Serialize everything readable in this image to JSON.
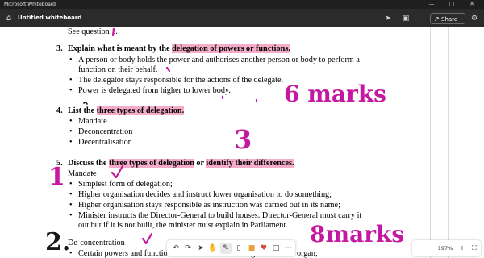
{
  "window": {
    "title": "Microsoft Whiteboard",
    "controls": [
      "minimize-icon",
      "maximize-icon",
      "close-icon"
    ]
  },
  "header": {
    "home_icon": "home-icon",
    "doc_title": "Untitled whiteboard",
    "chevron": "chevron-down-icon",
    "icons": [
      "cursor-icon",
      "gift-icon",
      "settings-icon"
    ],
    "share_label": "Share",
    "share_icon": "share-icon"
  },
  "doc": {
    "line0": "See question 1.",
    "q3_num": "3.",
    "q3_pre": "Explain what is meant by the ",
    "q3_hl": "delegation of powers or functions.",
    "q3_b1a": "A person or body holds the power and authorises another person or body to perform a",
    "q3_b1b": "function on their behalf.",
    "q3_b2": "The delegator stays responsible for the actions of the delegate.",
    "q3_b3": "Power is delegated from higher to lower body.",
    "q4_num": "4.",
    "q4_pre": "List the ",
    "q4_hl": "three types of delegation.",
    "q4_i1": "Mandate",
    "q4_i2": "Deconcentration",
    "q4_i3": "Decentralisation",
    "q5_num": "5.",
    "q5_pre": "Discuss the ",
    "q5_hl1": "three types of delegation",
    "q5_mid": " or ",
    "q5_hl2": "identify their differences.",
    "mandate_head": "Mandate",
    "m_b1": "Simplest form of delegation;",
    "m_b2": "Higher organisation decides and instruct lower organisation to do something;",
    "m_b3": "Higher organisation stays responsible as instruction was carried out in its name;",
    "m_b4a": "Minister instructs the Director-General to build houses.  Director-General must carry it",
    "m_b4b": "out but if it is not built, the minister must explain in Parliament.",
    "deconc_head": "De-concentration",
    "d_b1": "Certain powers and functions are transferred from higher to lower organ;"
  },
  "ink": {
    "marks6": "6 marks",
    "three": "3",
    "one": "1",
    "two": "2.",
    "marks8": "8marks",
    "color": "#c418a0"
  },
  "toolbar": {
    "tools": [
      "undo-icon",
      "redo-icon",
      "select-icon",
      "pan-icon",
      "pen-icon",
      "eraser-icon",
      "sticky-note-icon",
      "reaction-icon",
      "shapes-icon",
      "more-icon"
    ]
  },
  "zoom": {
    "zoom_out_icon": "zoom-out-icon",
    "value": "197%",
    "zoom_in_icon": "zoom-in-icon",
    "fit_icon": "fit-screen-icon"
  }
}
